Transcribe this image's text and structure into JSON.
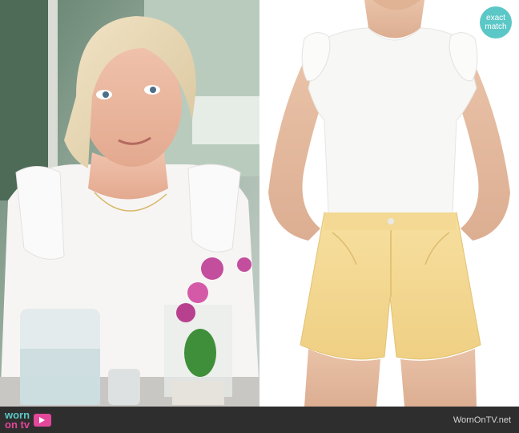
{
  "badge": {
    "line1": "exact",
    "line2": "match"
  },
  "footer": {
    "logo_word_1": "worn",
    "logo_word_2": "on tv",
    "site_label": "WornOnTV.net"
  },
  "colors": {
    "badge_bg": "#5cc7c7",
    "footer_bg": "#2e2e2e",
    "brand_pink": "#e2479a",
    "shorts_yellow": "#f6dc97",
    "tank_white": "#f7f7f5"
  },
  "images": {
    "left": "woman-in-white-ruffle-tank-at-table",
    "right": "model-in-white-ruffle-tank-and-yellow-shorts"
  }
}
